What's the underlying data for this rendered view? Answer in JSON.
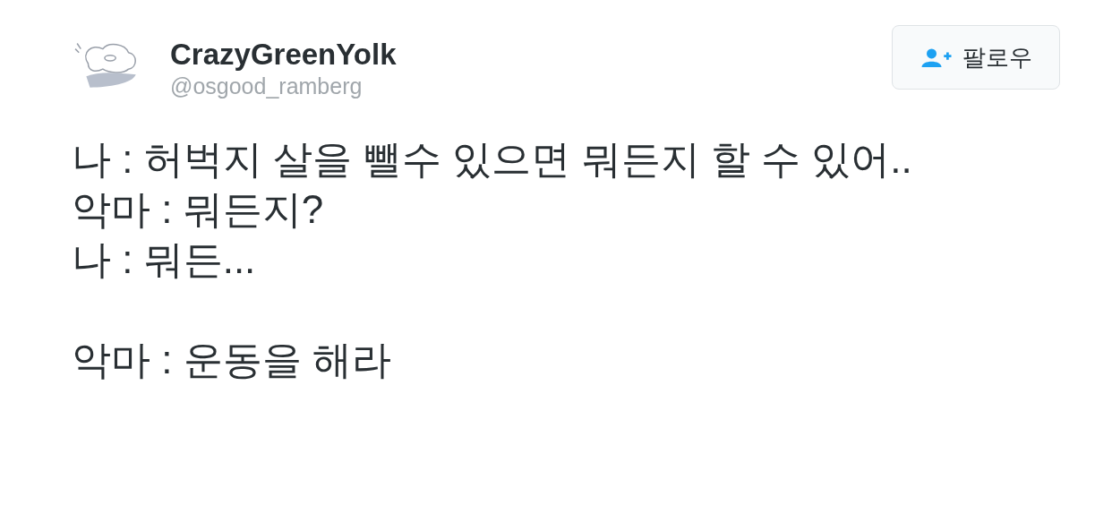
{
  "author": {
    "name": "CrazyGreenYolk",
    "handle": "@osgood_ramberg"
  },
  "follow_button": {
    "label": "팔로우"
  },
  "tweet_text": "나 : 허벅지 살을 뺄수 있으면 뭐든지 할 수 있어..\n악마 : 뭐든지?\n나 : 뭐든...\n\n악마 : 운동을 해라"
}
